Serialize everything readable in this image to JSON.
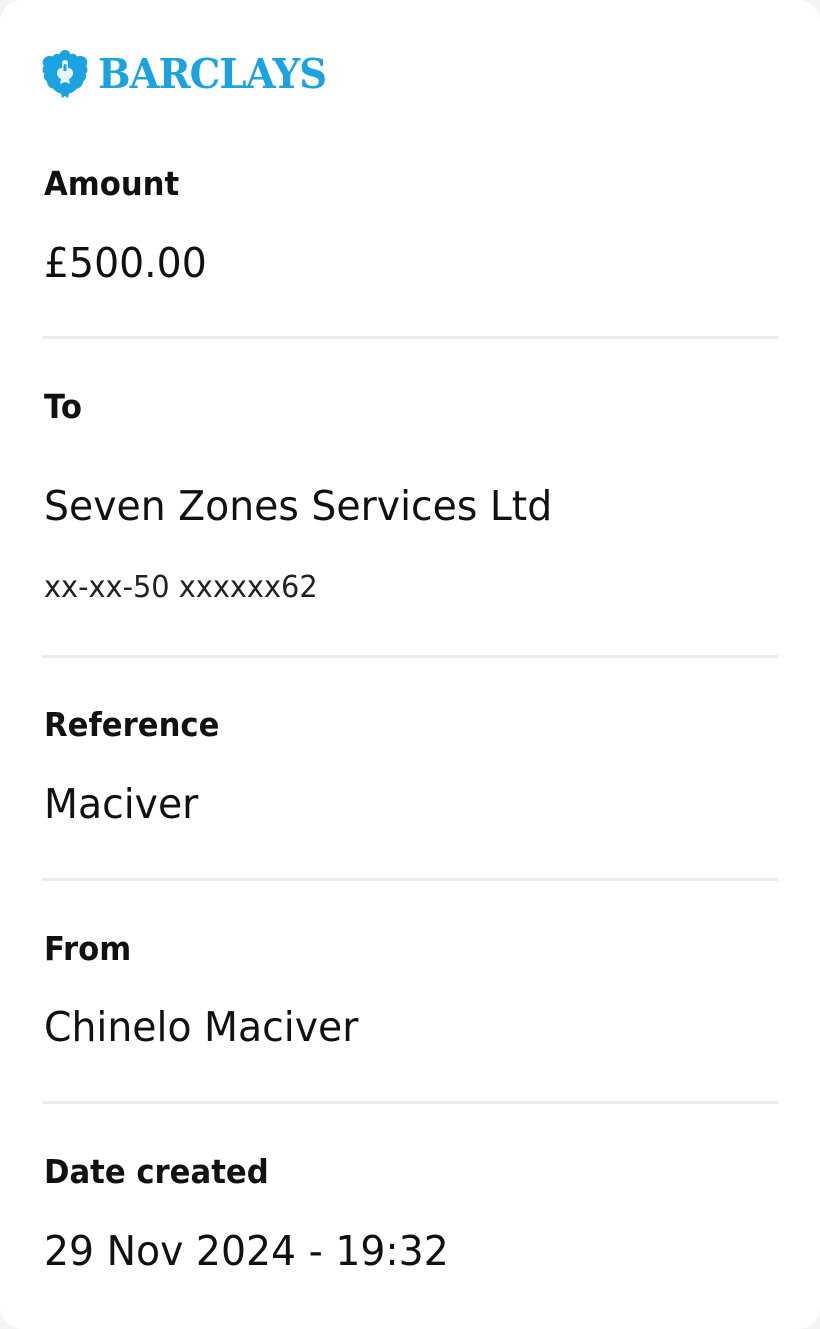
{
  "brand": {
    "name": "BARCLAYS",
    "icon": "eagle-icon",
    "color": "#1aa3e0"
  },
  "payment": {
    "amount_label": "Amount",
    "amount_value": "£500.00",
    "to_label": "To",
    "to_name": "Seven Zones Services Ltd",
    "to_account": "xx-xx-50 xxxxxx62",
    "reference_label": "Reference",
    "reference_value": "Maciver",
    "from_label": "From",
    "from_value": "Chinelo Maciver",
    "date_label": "Date created",
    "date_value": "29 Nov 2024 - 19:32"
  }
}
